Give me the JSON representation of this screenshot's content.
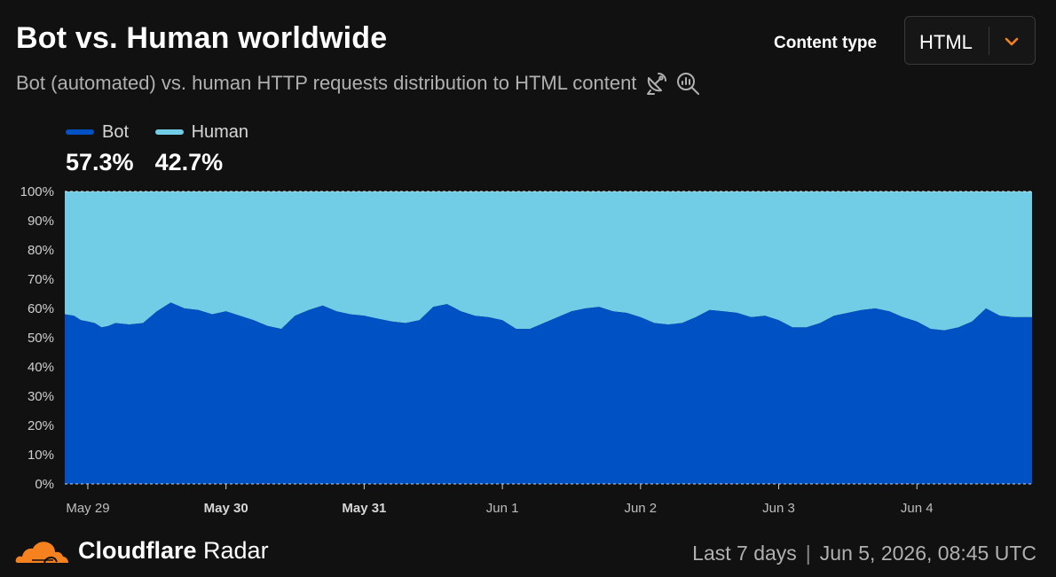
{
  "header": {
    "title": "Bot vs. Human worldwide",
    "subtitle": "Bot (automated) vs. human HTTP requests distribution to HTML content",
    "icons": [
      "satellite-dish-icon",
      "search-chart-icon"
    ],
    "content_type_label": "Content type",
    "content_type_value": "HTML"
  },
  "legend": {
    "bot": {
      "label": "Bot",
      "value": "57.3%"
    },
    "human": {
      "label": "Human",
      "value": "42.7%"
    }
  },
  "colors": {
    "bot": "#0051c3",
    "human": "#71cce6",
    "background": "#111111",
    "accent": "#f6821f"
  },
  "footer": {
    "brand_bold": "Cloudflare",
    "brand_light": "Radar",
    "range": "Last 7 days",
    "timestamp": "Jun 5, 2026, 08:45 UTC"
  },
  "chart_data": {
    "type": "area",
    "stacked": true,
    "normalized": true,
    "title": "Bot vs. Human worldwide",
    "ylim": [
      0,
      100
    ],
    "yticks": [
      "0%",
      "10%",
      "20%",
      "30%",
      "40%",
      "50%",
      "60%",
      "70%",
      "80%",
      "90%",
      "100%"
    ],
    "xlim": [
      -0.1667,
      6.8333
    ],
    "xticks": [
      {
        "x": 0,
        "label": "May 29",
        "bold": false
      },
      {
        "x": 1,
        "label": "May 30",
        "bold": true
      },
      {
        "x": 2,
        "label": "May 31",
        "bold": true
      },
      {
        "x": 3,
        "label": "Jun 1",
        "bold": false
      },
      {
        "x": 4,
        "label": "Jun 2",
        "bold": false
      },
      {
        "x": 5,
        "label": "Jun 3",
        "bold": false
      },
      {
        "x": 6,
        "label": "Jun 4",
        "bold": false
      }
    ],
    "x": [
      -0.1667,
      -0.1,
      -0.05,
      0,
      0.05,
      0.1,
      0.15,
      0.2,
      0.3,
      0.4,
      0.5,
      0.6,
      0.7,
      0.8,
      0.9,
      1.0,
      1.1,
      1.2,
      1.3,
      1.4,
      1.5,
      1.6,
      1.7,
      1.8,
      1.9,
      2.0,
      2.1,
      2.2,
      2.3,
      2.4,
      2.5,
      2.6,
      2.7,
      2.8,
      2.9,
      3.0,
      3.1,
      3.2,
      3.3,
      3.4,
      3.5,
      3.6,
      3.7,
      3.8,
      3.9,
      4.0,
      4.1,
      4.2,
      4.3,
      4.4,
      4.5,
      4.6,
      4.7,
      4.8,
      4.9,
      5.0,
      5.1,
      5.2,
      5.3,
      5.4,
      5.5,
      5.6,
      5.7,
      5.8,
      5.9,
      6.0,
      6.1,
      6.2,
      6.3,
      6.4,
      6.5,
      6.6,
      6.7,
      6.8333
    ],
    "series": [
      {
        "name": "Bot",
        "values": [
          58,
          57.5,
          56,
          55.5,
          55,
          53.5,
          54,
          55,
          54.5,
          55,
          59,
          62,
          60,
          59.5,
          58,
          59,
          57.5,
          56,
          54,
          53,
          57.5,
          59.5,
          61,
          59,
          58,
          57.5,
          56.5,
          55.5,
          55,
          56,
          60.5,
          61.5,
          59,
          57.5,
          57,
          56,
          53,
          53,
          55,
          57,
          59,
          60,
          60.5,
          59,
          58.5,
          57,
          55,
          54.5,
          55,
          57,
          59.5,
          59,
          58.5,
          57,
          57.5,
          56,
          53.5,
          53.5,
          55,
          57.5,
          58.5,
          59.5,
          60,
          59,
          57,
          55.5,
          53,
          52.5,
          53.5,
          55.5,
          60,
          57.5,
          57,
          57
        ]
      },
      {
        "name": "Human",
        "values": [
          42,
          42.5,
          44,
          44.5,
          45,
          46.5,
          46,
          45,
          45.5,
          45,
          41,
          38,
          40,
          40.5,
          42,
          41,
          42.5,
          44,
          46,
          47,
          42.5,
          40.5,
          39,
          41,
          42,
          42.5,
          43.5,
          44.5,
          45,
          44,
          39.5,
          38.5,
          41,
          42.5,
          43,
          44,
          47,
          47,
          45,
          43,
          41,
          40,
          39.5,
          41,
          41.5,
          43,
          45,
          45.5,
          45,
          43,
          40.5,
          41,
          41.5,
          43,
          42.5,
          44,
          46.5,
          46.5,
          45,
          42.5,
          41.5,
          40.5,
          40,
          41,
          43,
          44.5,
          47,
          47.5,
          46.5,
          44.5,
          40,
          42.5,
          43,
          43
        ]
      }
    ]
  }
}
